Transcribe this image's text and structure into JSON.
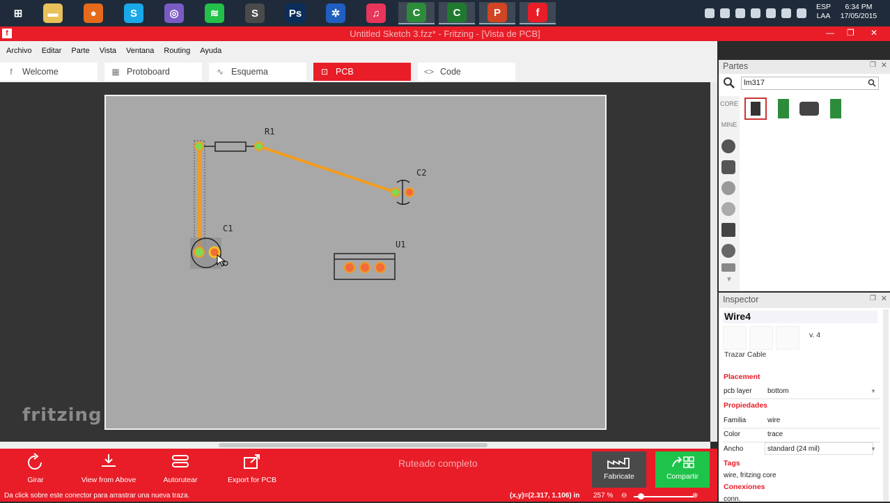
{
  "taskbar": {
    "apps": [
      {
        "name": "start",
        "glyph": "⊞",
        "color": "#1f2b3a"
      },
      {
        "name": "file-explorer",
        "glyph": "▬",
        "color": "#e8c15a"
      },
      {
        "name": "firefox",
        "glyph": "●",
        "color": "#e66a1c"
      },
      {
        "name": "skype",
        "glyph": "S",
        "color": "#19a8e8"
      },
      {
        "name": "tor",
        "glyph": "◎",
        "color": "#7a5bc4"
      },
      {
        "name": "spotify",
        "glyph": "≋",
        "color": "#23c04a"
      },
      {
        "name": "sublime",
        "glyph": "S",
        "color": "#4a4a4a"
      },
      {
        "name": "photoshop",
        "glyph": "Ps",
        "color": "#0a2d5a"
      },
      {
        "name": "settings",
        "glyph": "✲",
        "color": "#1e5fc0"
      },
      {
        "name": "itunes",
        "glyph": "♫",
        "color": "#e8355a"
      },
      {
        "name": "camtasia-1",
        "glyph": "C",
        "color": "#2c8c3a"
      },
      {
        "name": "camtasia-2",
        "glyph": "C",
        "color": "#1f7a2f"
      },
      {
        "name": "powerpoint",
        "glyph": "P",
        "color": "#d14424"
      },
      {
        "name": "fritzing",
        "glyph": "f",
        "color": "#e81d28"
      }
    ],
    "lang_top": "ESP",
    "lang_bottom": "LAA",
    "time": "6:34 PM",
    "date": "17/05/2015"
  },
  "window": {
    "title": "Untitled Sketch 3.fzz* - Fritzing - [Vista de PCB]",
    "logo": "f"
  },
  "menu": [
    "Archivo",
    "Editar",
    "Parte",
    "Vista",
    "Ventana",
    "Routing",
    "Ayuda"
  ],
  "tabs": [
    {
      "label": "Welcome",
      "icon": "f"
    },
    {
      "label": "Protoboard",
      "icon": "▦"
    },
    {
      "label": "Esquema",
      "icon": "∿"
    },
    {
      "label": "PCB",
      "icon": "⊡",
      "active": true
    },
    {
      "label": "Code",
      "icon": "<>"
    }
  ],
  "canvas": {
    "brand": "fritzing",
    "labels": {
      "r1": "R1",
      "c2": "C2",
      "c1": "C1",
      "u1": "U1"
    },
    "trace_color": "#f39c1e",
    "connector_green": "#7ed957",
    "connector_orange": "#f26b3a"
  },
  "parts": {
    "header": "Partes",
    "search_value": "lm317",
    "bins": [
      "CORE",
      "MINE"
    ]
  },
  "inspector": {
    "header": "Inspector",
    "title": "Wire4",
    "version": "v. 4",
    "description": "Trazar Cable",
    "placement_label": "Placement",
    "pcb_layer_key": "pcb layer",
    "pcb_layer_value": "bottom",
    "properties_label": "Propiedades",
    "family_key": "Familia",
    "family_value": "wire",
    "color_key": "Color",
    "color_value": "trace",
    "width_key": "Ancho",
    "width_value": "standard (24 mil)",
    "tags_label": "Tags",
    "tags_value": "wire, fritzing core",
    "connections_label": "Conexiones",
    "connections_value": "conn."
  },
  "toolbar": {
    "rotate": "Girar",
    "view_above": "View from Above",
    "autoroute": "Autorutear",
    "export": "Export for PCB",
    "status": "Ruteado completo",
    "fabricate": "Fabricate",
    "share": "Compartir"
  },
  "statusbar": {
    "hint": "Da click sobre este conector para arrastrar una nueva traza.",
    "coords": "(x,y)=(2.317, 1.106) in",
    "zoom": "257 %"
  }
}
